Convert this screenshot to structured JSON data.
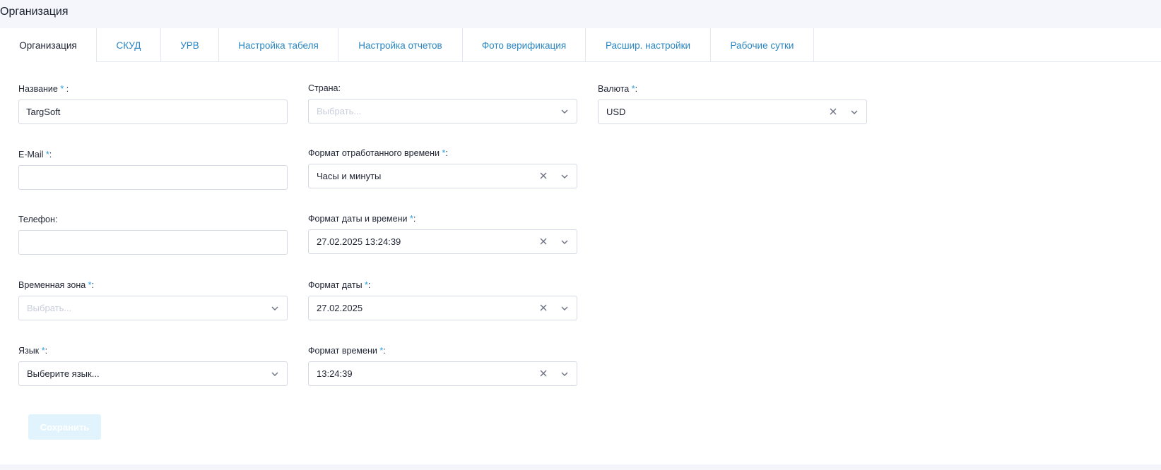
{
  "page_title": "Организация",
  "tabs": [
    {
      "label": "Организация",
      "active": true
    },
    {
      "label": "СКУД"
    },
    {
      "label": "УРВ"
    },
    {
      "label": "Настройка табеля"
    },
    {
      "label": "Настройка отчетов"
    },
    {
      "label": "Фото верификация"
    },
    {
      "label": "Расшир. настройки"
    },
    {
      "label": "Рабочие сутки"
    }
  ],
  "required_mark": "*",
  "fields": {
    "name": {
      "label": "Название",
      "suffix": " :",
      "value": "TargSoft"
    },
    "email": {
      "label": "E-Mail",
      "suffix": ":",
      "value": ""
    },
    "phone": {
      "label": "Телефон:",
      "value": ""
    },
    "timezone": {
      "label": "Временная зона",
      "suffix": ":",
      "value": "Выбрать..."
    },
    "language": {
      "label": "Язык",
      "suffix": ":",
      "value": "Выберите язык..."
    },
    "country": {
      "label": "Страна:",
      "value": "Выбрать..."
    },
    "worked_time_format": {
      "label": "Формат отработанного времени",
      "suffix": ":",
      "value": "Часы и минуты"
    },
    "datetime_format": {
      "label": "Формат даты и времени",
      "suffix": ":",
      "value": "27.02.2025 13:24:39"
    },
    "date_format": {
      "label": "Формат даты",
      "suffix": ":",
      "value": "27.02.2025"
    },
    "time_format": {
      "label": "Формат времени",
      "suffix": ":",
      "value": "13:24:39"
    },
    "currency": {
      "label": "Валюта",
      "suffix": ":",
      "value": "USD"
    }
  },
  "save_label": "Сохранить",
  "colors": {
    "tab_link": "#2b86c0",
    "required": "#2d9cdb",
    "save_bg": "#e1f4fd",
    "border": "#d5d9e3"
  },
  "icons": {
    "clear": "close-icon",
    "dropdown": "chevron-down-icon"
  }
}
